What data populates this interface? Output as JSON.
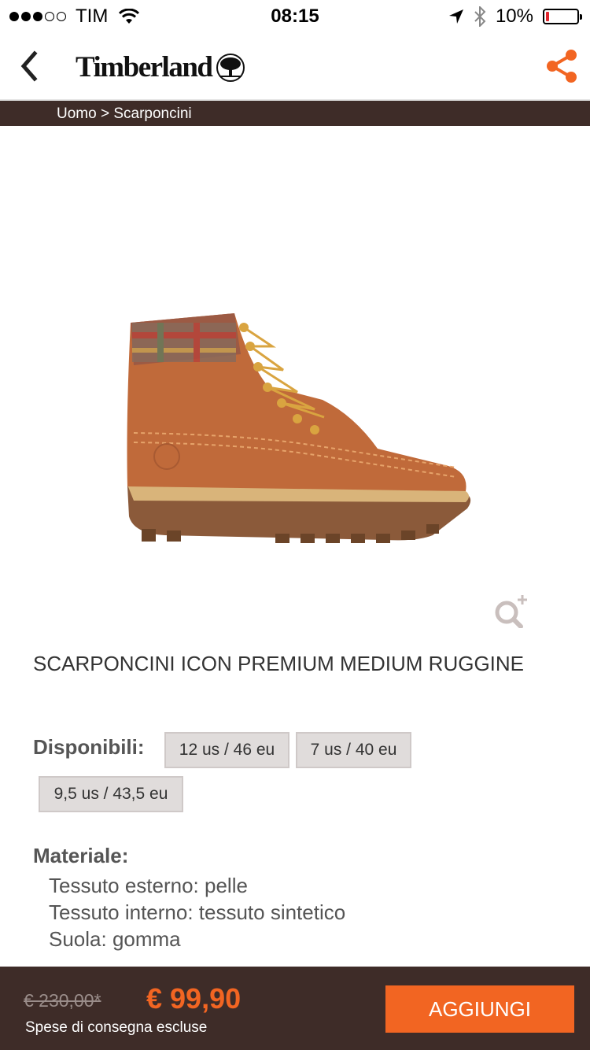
{
  "status_bar": {
    "carrier": "TIM",
    "time": "08:15",
    "battery_text": "10%",
    "battery_level": 0.1,
    "signal_bars": 3
  },
  "header": {
    "brand": "Timberland",
    "accent_color": "#f26522"
  },
  "breadcrumb": {
    "category": "Uomo",
    "separator": ">",
    "subcategory": "Scarponcini"
  },
  "product": {
    "title": "SCARPONCINI ICON PREMIUM MEDIUM RUGGINE",
    "available_label": "Disponibili:",
    "sizes": [
      "12 us / 46 eu",
      "7 us / 40 eu",
      "9,5 us / 43,5 eu"
    ],
    "material_label": "Materiale:",
    "materials": [
      "Tessuto esterno: pelle",
      "Tessuto interno: tessuto sintetico",
      "Suola: gomma"
    ]
  },
  "footer": {
    "old_price": "€ 230,00*",
    "price": "€ 99,90",
    "shipping_note": "Spese di consegna escluse",
    "add_button": "AGGIUNGI"
  }
}
